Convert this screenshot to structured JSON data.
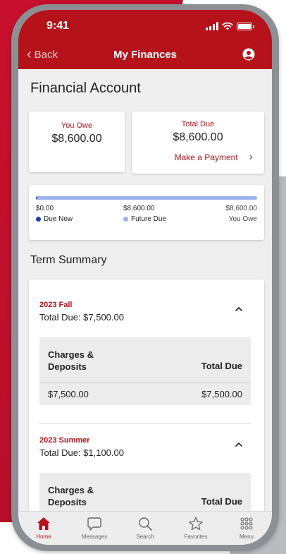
{
  "status": {
    "time": "9:41"
  },
  "nav": {
    "back_label": "Back",
    "title": "My Finances"
  },
  "page": {
    "title": "Financial Account"
  },
  "you_owe": {
    "label": "You Owe",
    "amount": "$8,600.00"
  },
  "total_due": {
    "label": "Total Due",
    "amount": "$8,600.00",
    "action_label": "Make a Payment"
  },
  "progress": {
    "due_now_value": "$0.00",
    "future_due_value": "$8,600.00",
    "you_owe_value": "$8,600.00",
    "due_now_label": "Due Now",
    "future_due_label": "Future Due",
    "you_owe_label": "You Owe",
    "due_now_fraction": 0.0,
    "future_due_fraction": 1.0
  },
  "term_summary": {
    "title": "Term Summary",
    "terms": [
      {
        "name": "2023 Fall",
        "total": "Total Due: $7,500.00",
        "col1_header": "Charges & Deposits",
        "col2_header": "Total Due",
        "charges": "$7,500.00",
        "total_due": "$7,500.00"
      },
      {
        "name": "2023 Summer",
        "total": "Total Due: $1,100.00",
        "col1_header": "Charges & Deposits",
        "col2_header": "Total Due"
      }
    ]
  },
  "tabs": [
    {
      "label": "Home",
      "icon": "home-icon",
      "active": true
    },
    {
      "label": "Messages",
      "icon": "message-icon",
      "active": false
    },
    {
      "label": "Search",
      "icon": "search-icon",
      "active": false
    },
    {
      "label": "Favorites",
      "icon": "star-icon",
      "active": false
    },
    {
      "label": "Menu",
      "icon": "grid-icon",
      "active": false
    }
  ],
  "colors": {
    "brand": "#b5121b",
    "due_now": "#1c3fa8",
    "future_due": "#9cb4f2"
  }
}
